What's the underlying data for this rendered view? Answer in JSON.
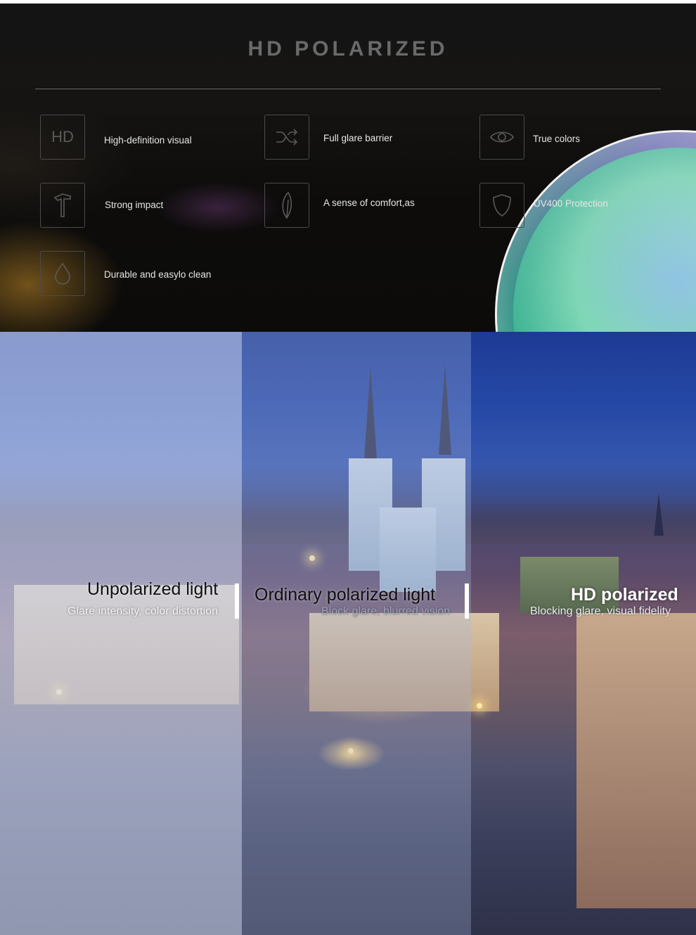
{
  "features": {
    "title": "HD POLARIZED",
    "hd_icon_text": "HD",
    "items": [
      {
        "icon": "hd-icon",
        "label": "High-definition visual"
      },
      {
        "icon": "shuffle-icon",
        "label": "Full glare barrier"
      },
      {
        "icon": "eye-icon",
        "label": "True colors"
      },
      {
        "icon": "hammer-icon",
        "label": "Strong impact"
      },
      {
        "icon": "feather-icon",
        "label": "A sense of comfort,as"
      },
      {
        "icon": "shield-icon",
        "label": "UV400 Protection"
      },
      {
        "icon": "water-drop-icon",
        "label": "Durable and easylo clean"
      }
    ]
  },
  "comparison": {
    "panels": [
      {
        "title": "Unpolarized light",
        "subtitle": "Glare intensity, color distortion"
      },
      {
        "title": "Ordinary polarized light",
        "subtitle": "Block glare, blurred vision"
      },
      {
        "title": "HD polarized",
        "subtitle": "Blocking glare, visual fidelity"
      }
    ]
  },
  "colors": {
    "panel_background": "#0e0d0c",
    "title_gray": "#6a6a6a",
    "label_text": "#e6e6e6",
    "icon_stroke": "#5a5a5a",
    "lens_teal": "#2a9d86",
    "night_sky_blue": "#1d3a94"
  }
}
